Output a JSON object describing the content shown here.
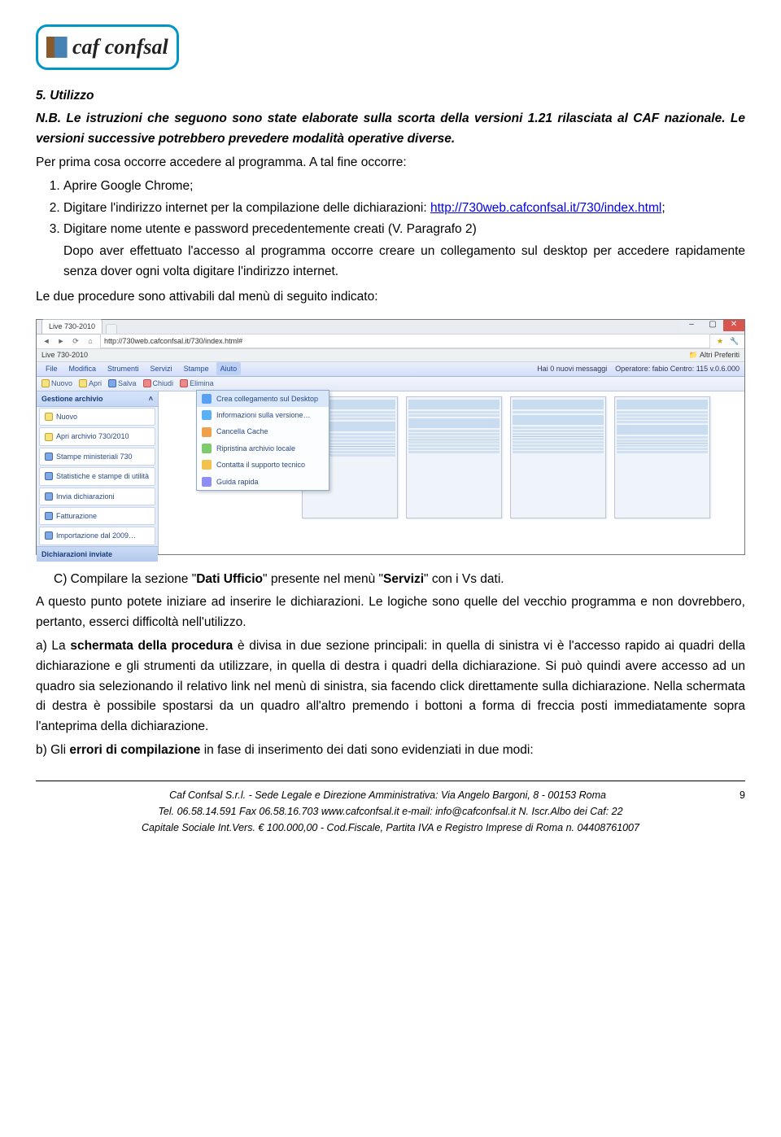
{
  "logo": {
    "text": "caf confsal"
  },
  "section5": {
    "heading": "5. Utilizzo",
    "note": "N.B. Le istruzioni che seguono sono state elaborate sulla scorta della versioni 1.21 rilasciata al CAF nazionale. Le versioni successive potrebbero prevedere modalità operative diverse.",
    "intro1": "Per prima cosa occorre accedere al programma. A tal fine occorre:",
    "li1": "Aprire Google Chrome;",
    "li2a": "Digitare l'indirizzo internet per la compilazione delle dichiarazioni: ",
    "li2link": "http://730web.cafconfsal.it/730/index.html",
    "li2b": ";",
    "li3": "Digitare nome utente e password precedentemente creati (V. Paragrafo 2)",
    "after3": "Dopo aver effettuato l'accesso al programma occorre creare un collegamento sul desktop per accedere rapidamente senza dover ogni volta digitare l'indirizzo internet.",
    "intro2": "Le due procedure sono attivabili dal menù di seguito indicato:",
    "pointC_leader": "C) Compilare la sezione \"",
    "pointC_bold1": "Dati Ufficio",
    "pointC_mid": "\" presente nel menù \"",
    "pointC_bold2": "Servizi",
    "pointC_tail": "\" con i Vs dati.",
    "p_after_c": "A questo punto potete iniziare ad inserire le dichiarazioni. Le logiche sono quelle del vecchio programma e non dovrebbero, pertanto, esserci difficoltà nell'utilizzo.",
    "pa_lead": "a) La ",
    "pa_bold": "schermata della procedura",
    "pa_rest": " è divisa in due sezione principali: in quella di sinistra vi è l'accesso rapido ai quadri della dichiarazione e gli strumenti da utilizzare, in quella di destra i quadri della dichiarazione. Si può quindi avere accesso ad un quadro sia selezionando il relativo link nel menù di sinistra, sia facendo click direttamente sulla dichiarazione. Nella schermata di destra è possibile spostarsi da un quadro all'altro premendo i bottoni a forma di freccia posti immediatamente sopra l'anteprima della dichiarazione.",
    "pb_lead": "b) Gli ",
    "pb_bold": "errori di compilazione",
    "pb_rest": " in fase di inserimento dei dati sono evidenziati in due modi:"
  },
  "screenshot": {
    "tab": "Live 730-2010",
    "url": "http://730web.cafconfsal.it/730/index.html#",
    "bm_left": "Live 730-2010",
    "bm_right": "Altri Preferiti",
    "menus": [
      "File",
      "Modifica",
      "Strumenti",
      "Servizi",
      "Stampe",
      "Aiuto"
    ],
    "active_menu": "Aiuto",
    "status_msg": "Hai 0 nuovi messaggi",
    "status_op": "Operatore: fabio  Centro: 115  v.0.6.000",
    "toolbar": [
      "Nuovo",
      "Apri",
      "Salva",
      "Chiudi",
      "Elimina"
    ],
    "sidebar": {
      "header": "Gestione archivio",
      "items": [
        "Nuovo",
        "Apri archivio 730/2010",
        "Stampe ministeriali 730",
        "Statistiche e stampe di utilità",
        "Invia dichiarazioni",
        "Fatturazione",
        "Importazione dal 2009…"
      ],
      "footer": "Dichiarazioni inviate"
    },
    "dropdown": [
      "Crea collegamento sul Desktop",
      "Informazioni sulla versione…",
      "Cancella Cache",
      "Ripristina archivio locale",
      "Contatta il supporto tecnico",
      "Guida rapida"
    ]
  },
  "footer": {
    "page_num": "9",
    "l1": "Caf Confsal S.r.l. - Sede Legale e Direzione Amministrativa: Via Angelo Bargoni, 8 - 00153 Roma",
    "l2a": "Tel. 06.58.14.591  Fax 06.58.16.703  ",
    "l2w": "www.cafconfsal.it",
    "l2m": "  e-mail: info@cafconfsal.it  N. Iscr.Albo dei Caf: 22",
    "l3": "Capitale Sociale Int.Vers. € 100.000,00 - Cod.Fiscale, Partita IVA e Registro Imprese di Roma n. 04408761007"
  }
}
